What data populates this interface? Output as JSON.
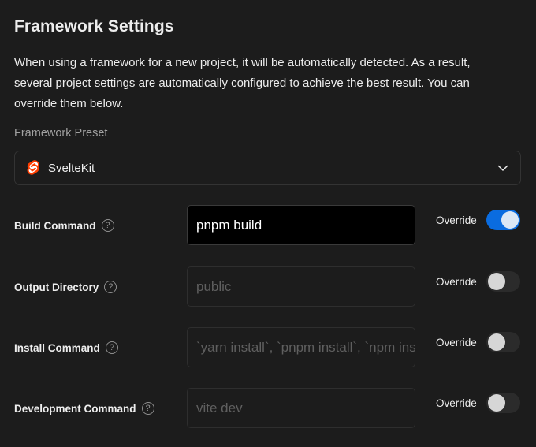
{
  "section": {
    "title": "Framework Settings",
    "description": "When using a framework for a new project, it will be automatically detected. As a result, several project settings are automatically configured to achieve the best result. You can override them below."
  },
  "preset": {
    "label": "Framework Preset",
    "value": "SvelteKit",
    "icon": "svelte-logo",
    "brand_color": "#ff3e00"
  },
  "rows": [
    {
      "label": "Build Command",
      "value": "pnpm build",
      "placeholder": "",
      "override_label": "Override",
      "override_on": true
    },
    {
      "label": "Output Directory",
      "value": "",
      "placeholder": "public",
      "override_label": "Override",
      "override_on": false
    },
    {
      "label": "Install Command",
      "value": "",
      "placeholder": "`yarn install`, `pnpm install`, `npm install`, or `bun install`",
      "override_label": "Override",
      "override_on": false
    },
    {
      "label": "Development Command",
      "value": "",
      "placeholder": "vite dev",
      "override_label": "Override",
      "override_on": false
    }
  ],
  "colors": {
    "background": "#1c1c1c",
    "toggle_on": "#0a6ce0",
    "toggle_off": "#2b2b2b"
  }
}
